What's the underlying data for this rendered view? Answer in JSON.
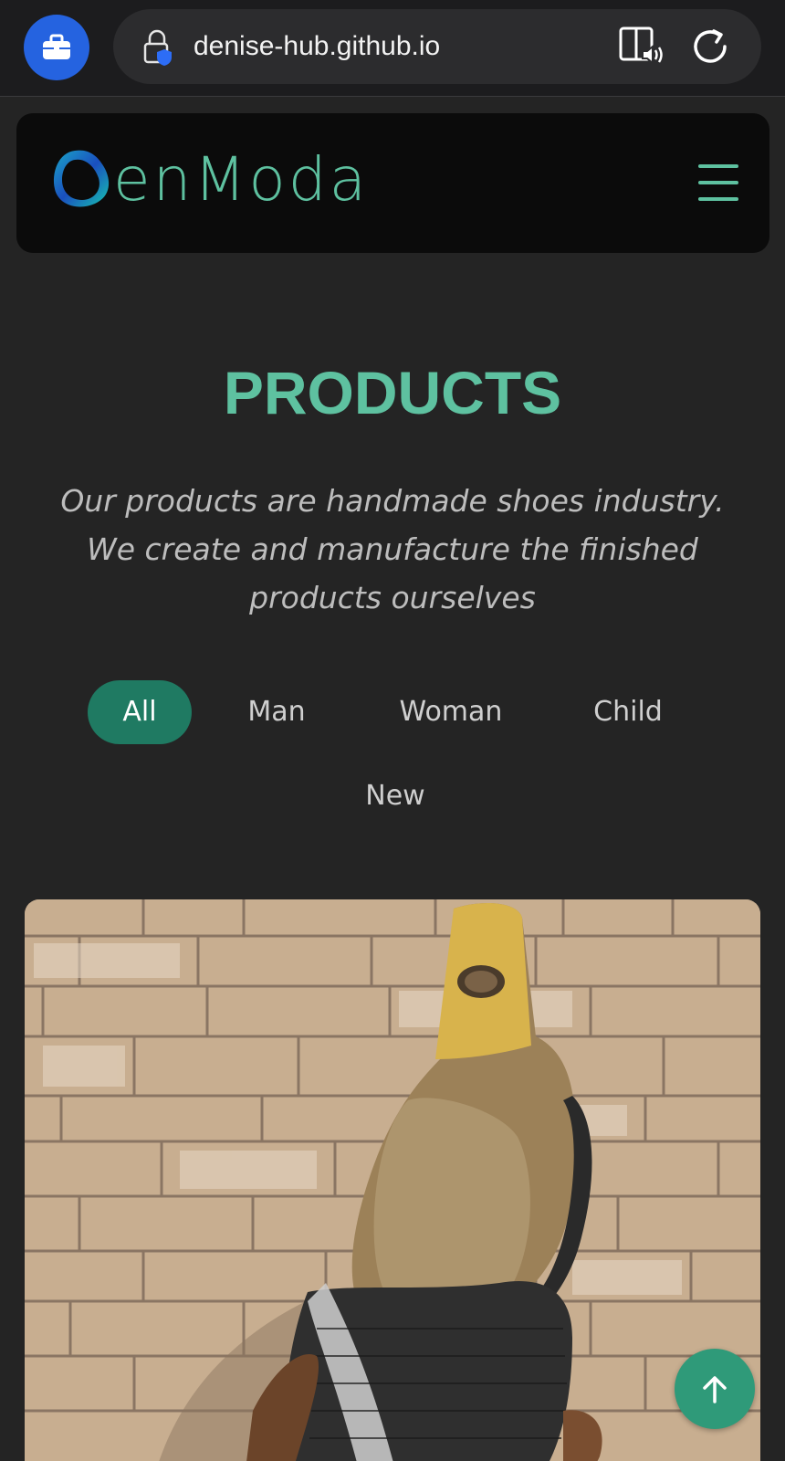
{
  "browser": {
    "url": "denise-hub.github.io",
    "left_button_icon": "briefcase-icon",
    "lock_icon": "lock-shield-icon",
    "reader_icon": "reader-speaker-icon",
    "reload_icon": "reload-icon"
  },
  "header": {
    "logo_text": "enModa",
    "menu_icon": "hamburger-icon"
  },
  "section": {
    "title": "PRODUCTS",
    "subtitle": "Our products are handmade shoes industry. We create and manufacture the finished products ourselves"
  },
  "filters": [
    {
      "label": "All",
      "active": true
    },
    {
      "label": "Man",
      "active": false
    },
    {
      "label": "Woman",
      "active": false
    },
    {
      "label": "Child",
      "active": false
    },
    {
      "label": "New",
      "active": false
    }
  ],
  "colors": {
    "accent": "#5ec1a0",
    "active_pill": "#1f7a62",
    "browser_blue": "#2563e0",
    "page_bg": "#242424"
  },
  "back_to_top_icon": "arrow-up-icon"
}
